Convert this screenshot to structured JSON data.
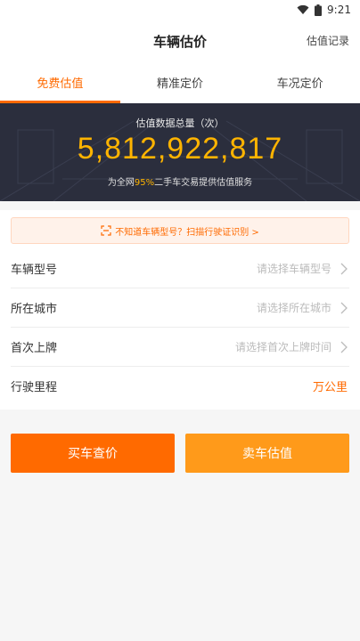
{
  "status_bar": {
    "time": "9:21"
  },
  "header": {
    "title": "车辆估价",
    "history_link": "估值记录"
  },
  "tabs": [
    {
      "label": "免费估值",
      "active": true
    },
    {
      "label": "精准定价",
      "active": false
    },
    {
      "label": "车况定价",
      "active": false
    }
  ],
  "banner": {
    "label": "估值数据总量（次）",
    "total": "5,812,922,817",
    "sub_prefix": "为全网",
    "sub_highlight": "95%",
    "sub_suffix": "二手车交易提供估值服务"
  },
  "scan_hint": "不知道车辆型号？扫描行驶证识别 >",
  "form": {
    "model": {
      "label": "车辆型号",
      "placeholder": "请选择车辆型号"
    },
    "city": {
      "label": "所在城市",
      "placeholder": "请选择所在城市"
    },
    "first_plate": {
      "label": "首次上牌",
      "placeholder": "请选择首次上牌时间"
    },
    "mileage": {
      "label": "行驶里程",
      "unit": "万公里"
    }
  },
  "buttons": {
    "buy": "买车查价",
    "sell": "卖车估值"
  },
  "colors": {
    "accent": "#ff6a00",
    "accent_light": "#ff9a1a",
    "banner_bg": "#2b2e3d",
    "number": "#ffb400"
  }
}
